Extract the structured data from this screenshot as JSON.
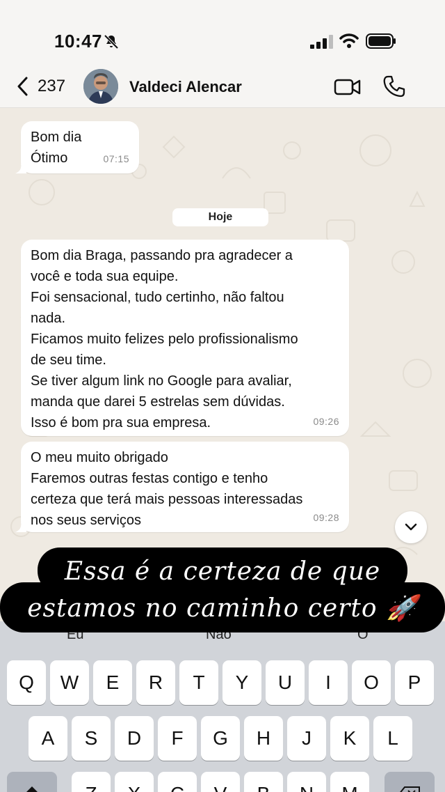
{
  "status": {
    "time": "10:47"
  },
  "header": {
    "back_count": "237",
    "contact_name": "Valdeci Alencar"
  },
  "messages": [
    {
      "lines": [
        "Bom dia",
        "Ótimo"
      ],
      "time": "07:15"
    },
    {
      "lines": [
        "Bom dia Braga, passando pra agradecer a",
        "você e toda sua equipe.",
        "Foi sensacional, tudo certinho, não faltou",
        "nada.",
        "Ficamos muito felizes pelo profissionalismo",
        "de seu time.",
        "Se tiver algum link no Google para avaliar,",
        "manda que darei 5 estrelas sem dúvidas.",
        "Isso é bom pra sua empresa."
      ],
      "time": "09:26"
    },
    {
      "lines": [
        "O meu muito obrigado",
        "Faremos outras festas contigo e tenho",
        "certeza que terá mais pessoas interessadas",
        "nos seus serviços"
      ],
      "time": "09:28"
    }
  ],
  "day_chip": "Hoje",
  "caption": {
    "line1": "Essa é a certeza de que",
    "line2": "estamos no caminho certo 🚀"
  },
  "keyboard": {
    "suggestions": [
      "Eu",
      "Não",
      "O"
    ],
    "row1": [
      "Q",
      "W",
      "E",
      "R",
      "T",
      "Y",
      "U",
      "I",
      "O",
      "P"
    ],
    "row2": [
      "A",
      "S",
      "D",
      "F",
      "G",
      "H",
      "J",
      "K",
      "L"
    ],
    "row3": [
      "Z",
      "X",
      "C",
      "V",
      "B",
      "N",
      "M"
    ]
  },
  "colors": {
    "chat_bg": "#efeae2",
    "bubble": "#ffffff",
    "keyboard_bg": "#d1d4d9",
    "caption_bg": "#000000"
  }
}
